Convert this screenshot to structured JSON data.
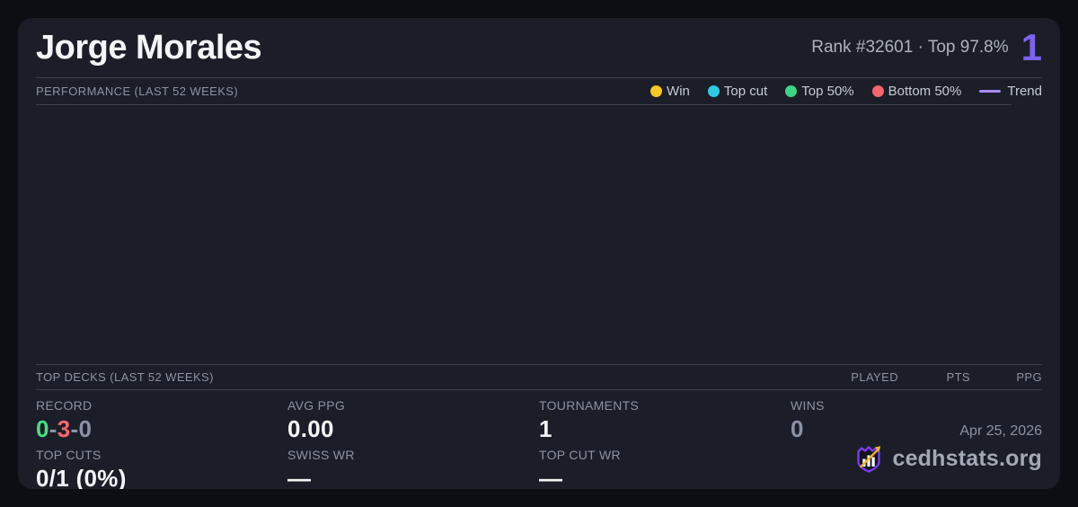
{
  "header": {
    "player_name": "Jorge Morales",
    "rank_text": "Rank #32601  ·  Top 97.8%",
    "count_badge": "1"
  },
  "performance": {
    "section_title": "PERFORMANCE (LAST 52 WEEKS)",
    "legend": [
      {
        "label": "Win",
        "color": "#f7c627",
        "type": "dot"
      },
      {
        "label": "Top cut",
        "color": "#2fc9e3",
        "type": "dot"
      },
      {
        "label": "Top 50%",
        "color": "#3ed488",
        "type": "dot"
      },
      {
        "label": "Bottom 50%",
        "color": "#f5666e",
        "type": "dot"
      },
      {
        "label": "Trend",
        "color": "#a78bfa",
        "type": "line"
      }
    ],
    "chart_points": []
  },
  "top_decks": {
    "section_title": "TOP DECKS (LAST 52 WEEKS)",
    "columns": [
      "PLAYED",
      "PTS",
      "PPG"
    ],
    "rows": []
  },
  "stats": {
    "record": {
      "label": "RECORD",
      "wins": "0",
      "sep": "-",
      "losses": "3",
      "draws": "0"
    },
    "avg_ppg": {
      "label": "AVG PPG",
      "value": "0.00"
    },
    "tournaments": {
      "label": "TOURNAMENTS",
      "value": "1"
    },
    "wins": {
      "label": "WINS",
      "value": "0"
    },
    "top_cuts": {
      "label": "TOP CUTS",
      "value": "0/1 (0%)"
    },
    "swiss_wr": {
      "label": "SWISS WR",
      "value": "—"
    },
    "top_cut_wr": {
      "label": "TOP CUT WR",
      "value": "—"
    }
  },
  "footer": {
    "date": "Apr 25, 2026",
    "site": "cedhstats.org"
  },
  "colors": {
    "bg_page": "#0c0e13",
    "bg_card": "#1b1e28",
    "divider": "#3a4152",
    "text_primary": "#f4f5f7",
    "text_muted": "#8b92a3",
    "text_soft": "#c6cbd6",
    "accent_purple": "#7e62ef",
    "record_green": "#4ade80",
    "record_red": "#f4686f",
    "value_dim": "#8b92a3",
    "logo_text": "#a2a8b4",
    "logo_purple": "#7c3aed",
    "logo_gold": "#f0b429",
    "logo_bars": "#ffffff"
  }
}
